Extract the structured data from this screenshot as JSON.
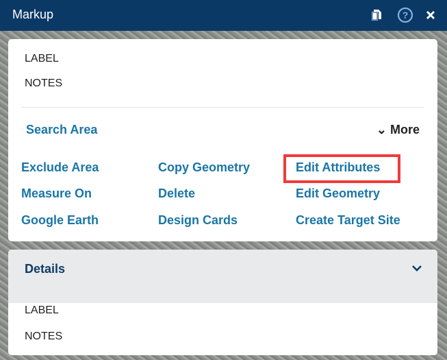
{
  "header": {
    "title": "Markup",
    "icons": [
      "copy-icon",
      "help-icon",
      "close-icon"
    ]
  },
  "markup": {
    "label": "LABEL",
    "notes": "NOTES",
    "search_area": "Search Area",
    "more": "More",
    "actions": [
      "Exclude Area",
      "Copy Geometry",
      "Edit Attributes",
      "Measure On",
      "Delete",
      "Edit Geometry",
      "Google Earth",
      "Design Cards",
      "Create Target Site"
    ],
    "highlighted_action": "Edit Attributes",
    "highlight_color": "#ef3b3b"
  },
  "details": {
    "title": "Details",
    "label": "LABEL",
    "notes": "NOTES"
  },
  "colors": {
    "header": "#0b3966",
    "link": "#1a76a6"
  }
}
